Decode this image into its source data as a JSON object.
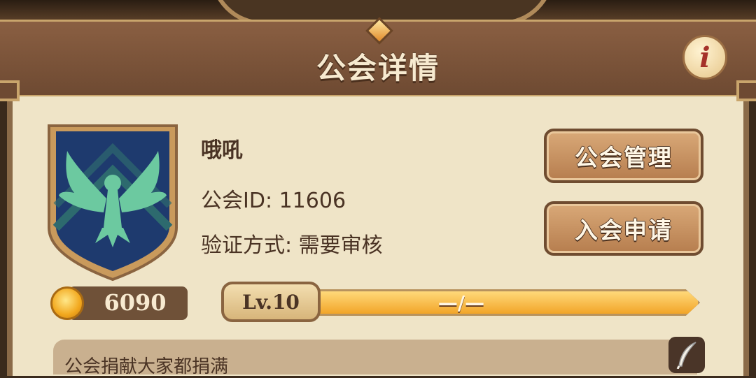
{
  "header": {
    "title": "公会详情",
    "info_icon": "info-icon",
    "info_glyph": "i"
  },
  "guild": {
    "name": "哦吼",
    "id_line": "公会ID: 11606",
    "verify_line": "验证方式: 需要审核",
    "coins": "6090",
    "level_label": "Lv.10",
    "xp_text": "—/—",
    "xp_progress": 1.0,
    "emblem_icon": "eagle-emblem-icon"
  },
  "buttons": {
    "manage": "公会管理",
    "apply": "入会申请"
  },
  "notice": {
    "text": "公会捐献大家都捐满",
    "edit_icon": "quill-edit-icon"
  },
  "colors": {
    "panel": "#efe4c7",
    "header": "#7a5238",
    "xp_fill": "#f2a528",
    "emblem_bg": "#1e3a6e",
    "eagle": "#6cc9a0"
  }
}
